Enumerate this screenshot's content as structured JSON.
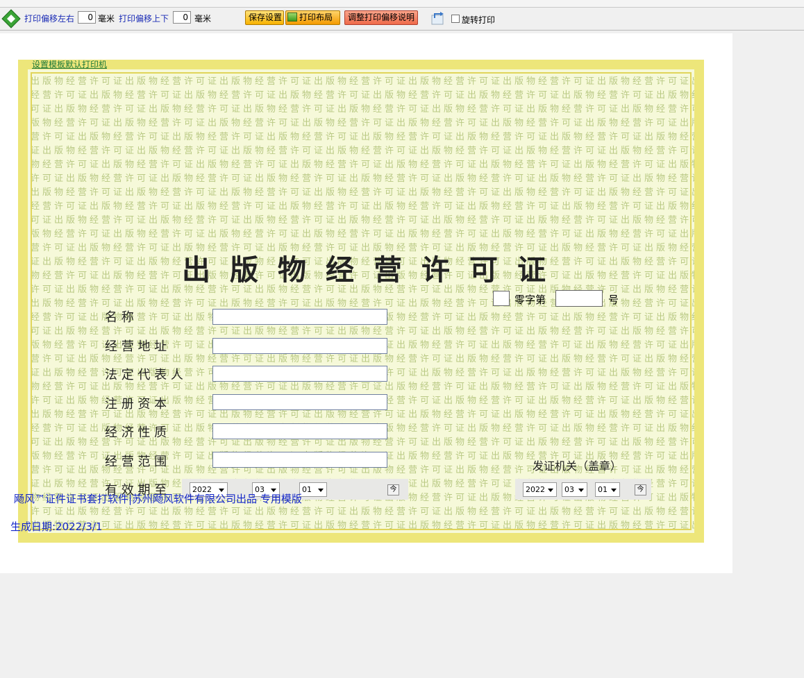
{
  "toolbar": {
    "offset_lr_label": "打印偏移左右",
    "offset_lr_value": "0",
    "offset_ud_label": "打印偏移上下",
    "offset_ud_value": "0",
    "unit": "毫米",
    "save_label": "保存设置",
    "layout_label": "打印布局",
    "adjust_label": "调整打印偏移说明",
    "rotate_label": "旋转打印"
  },
  "template": {
    "default_printer_link": "设置模板默认打印机",
    "title": "出版物经营许可证",
    "zero_label": "零字第",
    "hao_label": "号",
    "fields": [
      {
        "label": "名                称"
      },
      {
        "label": "经   营   地   址"
      },
      {
        "label": "法 定 代 表 人"
      },
      {
        "label": "注   册   资   本"
      },
      {
        "label": "经   济   性   质"
      },
      {
        "label": "经   营   范   围"
      }
    ],
    "validity_label": "有  效  期  至",
    "issuer": "发证机关（盖章）",
    "date1": {
      "year": "2022",
      "month": "03",
      "day": "01"
    },
    "date2": {
      "year": "2022",
      "month": "03",
      "day": "01"
    },
    "today_button": "今"
  },
  "footer": {
    "credit": "飏风™证件证书套打软件|苏州飏风软件有限公司出品 专用模版",
    "generated": "生成日期:2022/3/1"
  },
  "colors": {
    "link_blue": "#1326c8",
    "border_yellow": "#ede67a",
    "watermark_green": "#b9c984"
  },
  "icons": {
    "nav": "diamond-arrows-icon",
    "rotate": "rotate-icon"
  }
}
